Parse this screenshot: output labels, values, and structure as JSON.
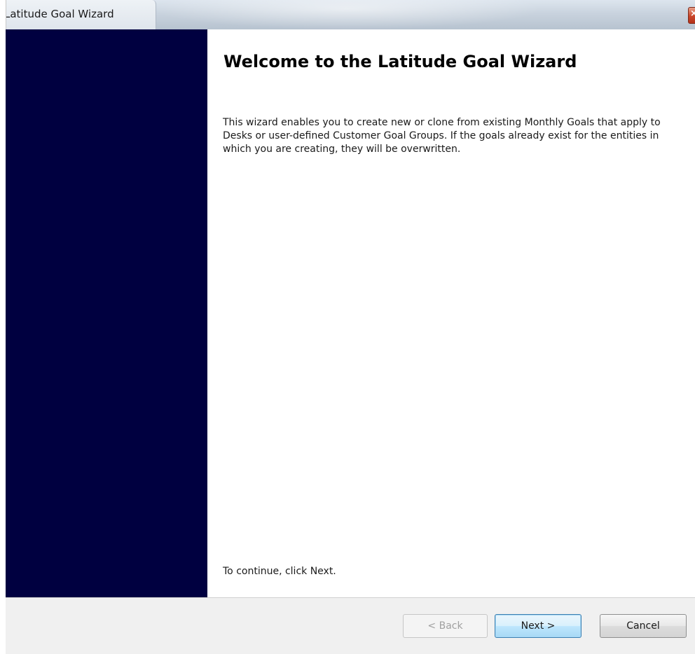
{
  "window": {
    "title": "Latitude Goal Wizard",
    "close_glyph": "×"
  },
  "content": {
    "heading": "Welcome to the Latitude Goal Wizard",
    "description": "This wizard enables you to create new or clone from existing Monthly Goals that apply to Desks or user-defined Customer Goal Groups.  If the goals already exist for the entities in which you are creating, they will be overwritten.",
    "continue_text": "To continue, click Next."
  },
  "buttons": {
    "back_label": "< Back",
    "next_label": "Next >",
    "cancel_label": "Cancel",
    "back_enabled": false
  },
  "colors": {
    "banner": "#000040",
    "footer": "#f0f0f0",
    "default_button_border": "#3c7fb1"
  }
}
